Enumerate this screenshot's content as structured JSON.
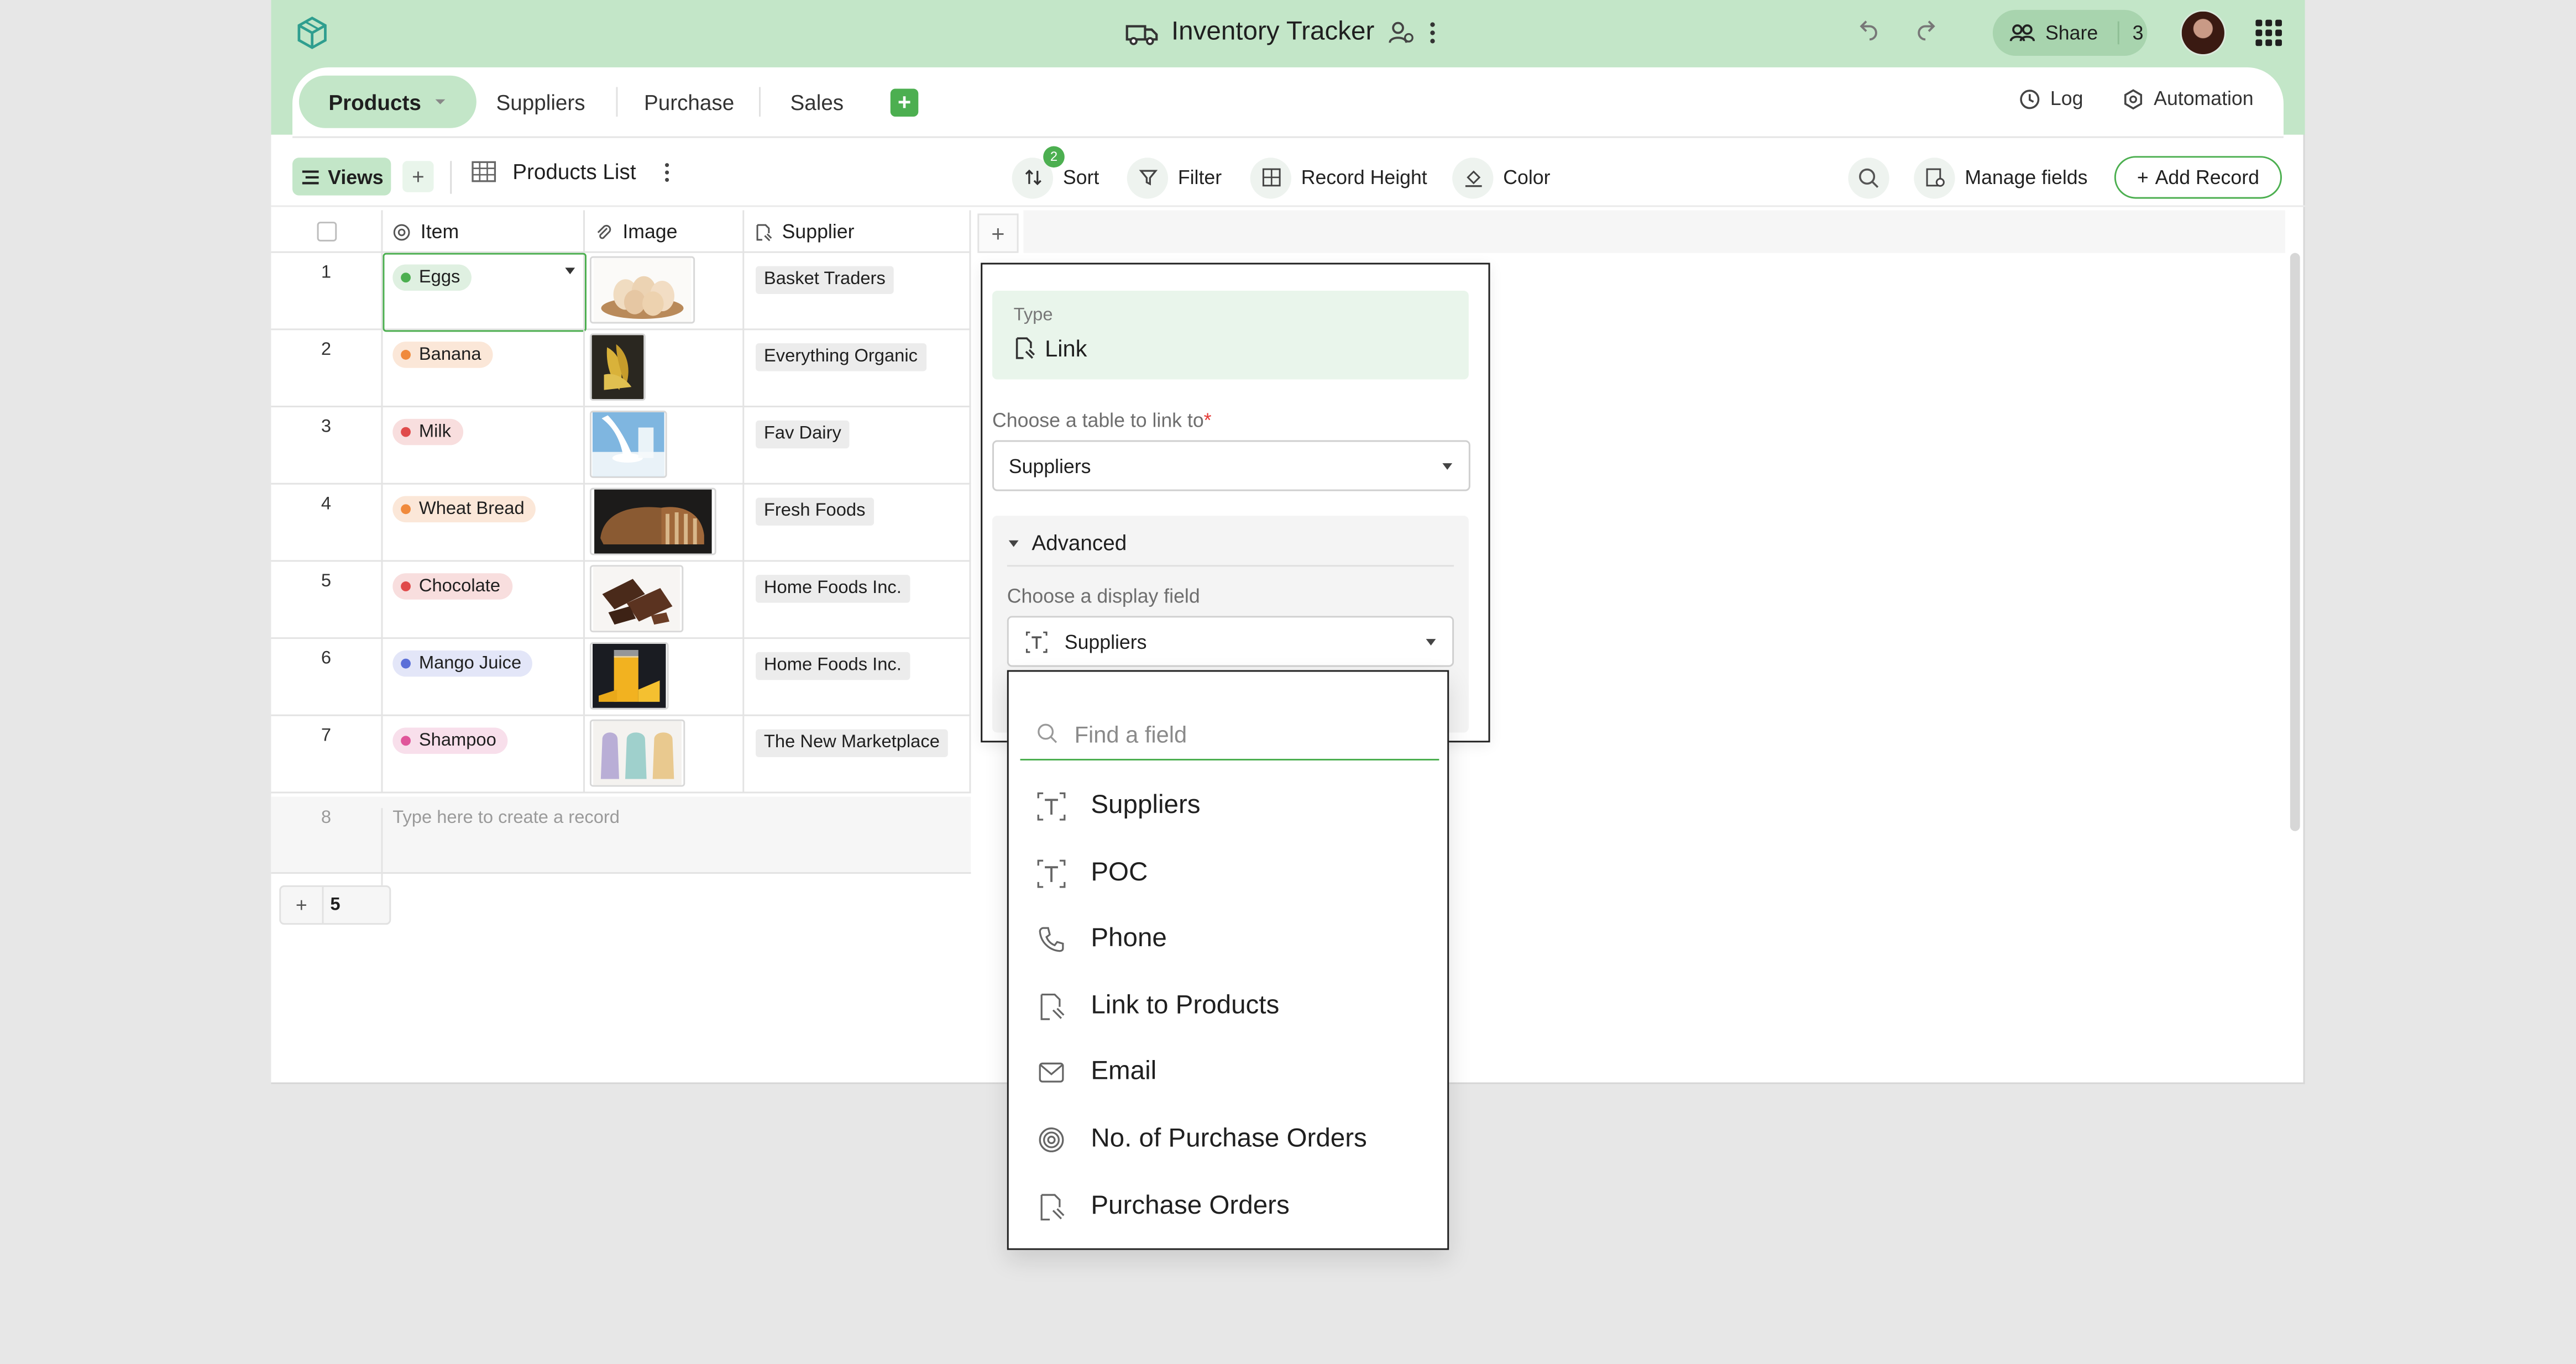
{
  "header": {
    "title": "Inventory Tracker",
    "share_label": "Share",
    "share_count": "3"
  },
  "tabs": [
    {
      "label": "Products",
      "active": true
    },
    {
      "label": "Suppliers",
      "active": false
    },
    {
      "label": "Purchase",
      "active": false
    },
    {
      "label": "Sales",
      "active": false
    }
  ],
  "tabbar_right": {
    "log_label": "Log",
    "automation_label": "Automation"
  },
  "toolbar": {
    "views_label": "Views",
    "view_name": "Products List",
    "sort_label": "Sort",
    "sort_count": "2",
    "filter_label": "Filter",
    "record_height_label": "Record Height",
    "color_label": "Color",
    "manage_fields_label": "Manage fields",
    "add_record_label": "Add Record"
  },
  "grid": {
    "columns": [
      {
        "label": "Item",
        "icon": "primary-field-icon"
      },
      {
        "label": "Image",
        "icon": "paperclip-icon"
      },
      {
        "label": "Supplier",
        "icon": "link-icon"
      }
    ],
    "rows": [
      {
        "num": "1",
        "item": "Eggs",
        "dot": "#4caf50",
        "pill_bg": "#dff0e1",
        "supplier": "Basket Traders",
        "image": "eggs"
      },
      {
        "num": "2",
        "item": "Banana",
        "dot": "#f08a3c",
        "pill_bg": "#fbe7d8",
        "supplier": "Everything Organic",
        "image": "banana"
      },
      {
        "num": "3",
        "item": "Milk",
        "dot": "#e04b4b",
        "pill_bg": "#f8dede",
        "supplier": "Fav Dairy",
        "image": "milk"
      },
      {
        "num": "4",
        "item": "Wheat Bread",
        "dot": "#f08a3c",
        "pill_bg": "#fbe7d8",
        "supplier": "Fresh Foods",
        "image": "bread"
      },
      {
        "num": "5",
        "item": "Chocolate",
        "dot": "#e04b4b",
        "pill_bg": "#f8dede",
        "supplier": "Home Foods Inc.",
        "image": "chocolate"
      },
      {
        "num": "6",
        "item": "Mango Juice",
        "dot": "#5b6fd8",
        "pill_bg": "#e3e6f8",
        "supplier": "Home Foods Inc.",
        "image": "juice"
      },
      {
        "num": "7",
        "item": "Shampoo",
        "dot": "#e0559a",
        "pill_bg": "#f8dfeb",
        "supplier": "The New Marketplace",
        "image": "shampoo"
      }
    ],
    "new_row_num": "8",
    "new_row_hint": "Type here to create a record",
    "footer_count": "5"
  },
  "field_panel": {
    "type_label": "Type",
    "type_value": "Link",
    "table_label": "Choose a table to link to",
    "table_required": "*",
    "table_value": "Suppliers",
    "advanced_label": "Advanced",
    "display_label": "Choose a display field",
    "display_value": "Suppliers"
  },
  "dropdown": {
    "search_placeholder": "Find a field",
    "options": [
      {
        "label": "Suppliers",
        "icon": "text-field-icon"
      },
      {
        "label": "POC",
        "icon": "text-field-icon"
      },
      {
        "label": "Phone",
        "icon": "phone-icon"
      },
      {
        "label": "Link to Products",
        "icon": "link-icon"
      },
      {
        "label": "Email",
        "icon": "email-icon"
      },
      {
        "label": "No. of Purchase Orders",
        "icon": "rollup-icon"
      },
      {
        "label": "Purchase Orders",
        "icon": "link-icon"
      }
    ]
  },
  "colors": {
    "accent": "#4caf50",
    "topbar": "#c3e6c8",
    "panel_tint": "#e9f5eb"
  }
}
